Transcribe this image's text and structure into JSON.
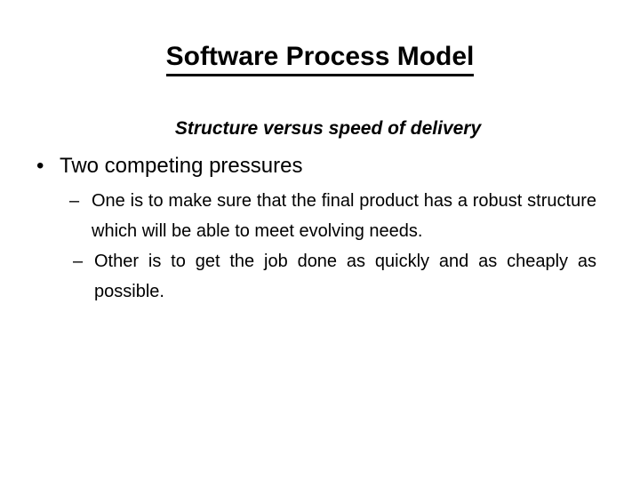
{
  "slide": {
    "title": "Software Process Model",
    "subtitle": "Structure versus speed of delivery",
    "bullets": [
      {
        "level": 1,
        "marker": "•",
        "text": "Two competing pressures",
        "children": [
          {
            "level": 2,
            "marker": "–",
            "text": "One is to make sure that the final product has a robust structure which will be able to meet evolving needs."
          },
          {
            "level": 2,
            "marker": "–",
            "text": "Other is to get the job done as quickly and as cheaply as possible."
          }
        ]
      }
    ]
  },
  "style": {
    "background_color": "#ffffff",
    "text_color": "#000000"
  }
}
